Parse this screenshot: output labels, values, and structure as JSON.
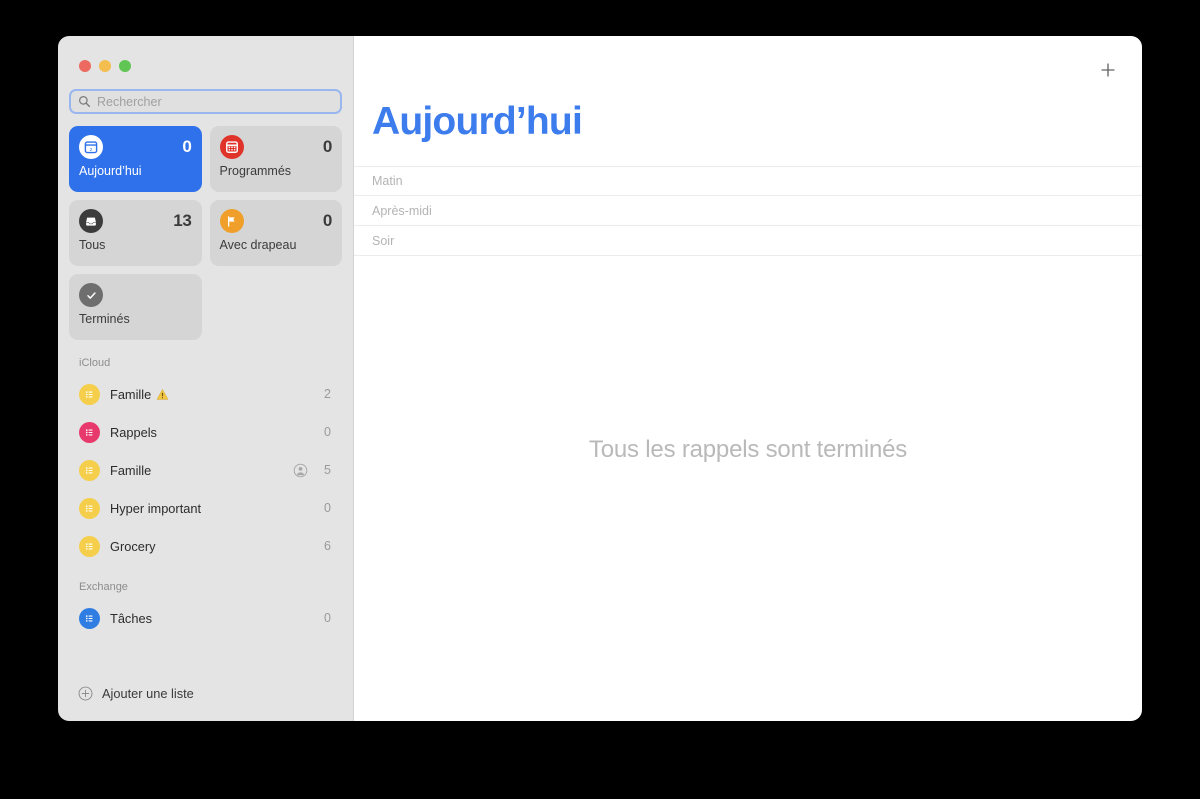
{
  "window": {
    "traffic_lights": [
      {
        "name": "close",
        "color": "#ec6a5f"
      },
      {
        "name": "minimize",
        "color": "#f4bd4f"
      },
      {
        "name": "maximize",
        "color": "#61c554"
      }
    ]
  },
  "search": {
    "placeholder": "Rechercher",
    "value": "",
    "icon": "search-icon"
  },
  "smart_cards": [
    {
      "label": "Aujourd’hui",
      "count": "0",
      "icon": "calendar-day-icon",
      "icon_bg": "#ffffff",
      "icon_fg": "#2f71eb",
      "active": true
    },
    {
      "label": "Programmés",
      "count": "0",
      "icon": "calendar-icon",
      "icon_bg": "#e0342b",
      "icon_fg": "#ffffff",
      "active": false
    },
    {
      "label": "Tous",
      "count": "13",
      "icon": "inbox-icon",
      "icon_bg": "#3c3c3c",
      "icon_fg": "#ffffff",
      "active": false
    },
    {
      "label": "Avec drapeau",
      "count": "0",
      "icon": "flag-icon",
      "icon_bg": "#f0a02a",
      "icon_fg": "#ffffff",
      "active": false
    },
    {
      "label": "Terminés",
      "count": "",
      "icon": "checkmark-icon",
      "icon_bg": "#6e6e6e",
      "icon_fg": "#ffffff",
      "active": false
    }
  ],
  "groups": [
    {
      "title": "iCloud",
      "lists": [
        {
          "name": "Famille",
          "count": "2",
          "color": "#f5cf4b",
          "icon": "list-icon",
          "warning": true,
          "shared": false
        },
        {
          "name": "Rappels",
          "count": "0",
          "color": "#e8396d",
          "icon": "list-icon",
          "warning": false,
          "shared": false
        },
        {
          "name": "Famille",
          "count": "5",
          "color": "#f5cf4b",
          "icon": "list-icon",
          "warning": false,
          "shared": true
        },
        {
          "name": "Hyper important",
          "count": "0",
          "color": "#f5cf4b",
          "icon": "list-icon",
          "warning": false,
          "shared": false
        },
        {
          "name": "Grocery",
          "count": "6",
          "color": "#f5cf4b",
          "icon": "list-icon",
          "warning": false,
          "shared": false
        }
      ]
    },
    {
      "title": "Exchange",
      "lists": [
        {
          "name": "Tâches",
          "count": "0",
          "color": "#2f7de3",
          "icon": "list-icon",
          "warning": false,
          "shared": false
        }
      ]
    }
  ],
  "sidebar_footer": {
    "add_list_label": "Ajouter une liste",
    "icon": "plus-circle-icon"
  },
  "main": {
    "title": "Aujourd’hui",
    "title_color": "#3d7ced",
    "add_reminder_icon": "plus-icon",
    "sections": [
      {
        "label": "Matin"
      },
      {
        "label": "Après-midi"
      },
      {
        "label": "Soir"
      }
    ],
    "empty_state": "Tous les rappels sont terminés"
  }
}
